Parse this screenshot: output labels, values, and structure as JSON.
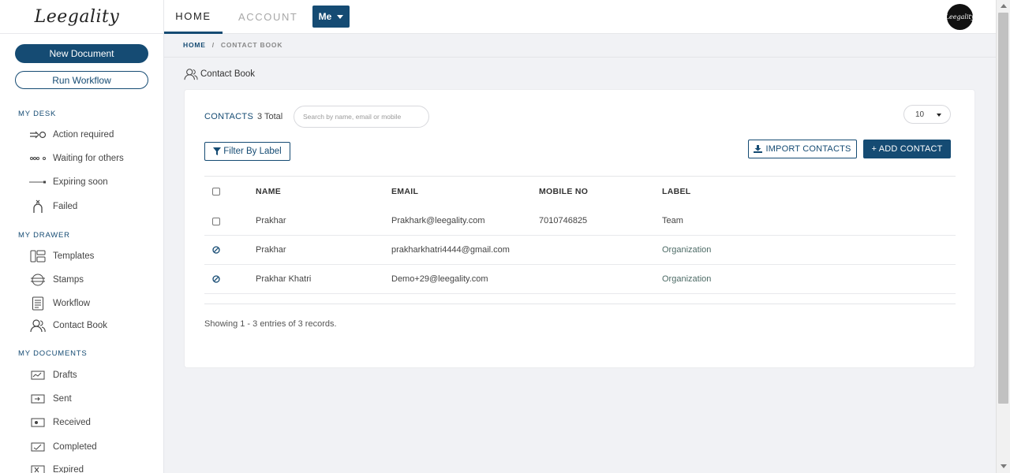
{
  "app": {
    "logo_text": "Leegality",
    "avatar_text": "Leegality"
  },
  "sidebar": {
    "new_document": "New Document",
    "run_workflow": "Run Workflow",
    "sections": {
      "my_desk": "MY DESK",
      "my_drawer": "MY DRAWER",
      "my_documents": "MY DOCUMENTS"
    },
    "desk_items": [
      {
        "label": "Action required",
        "icon": "action-required-icon"
      },
      {
        "label": "Waiting for others",
        "icon": "waiting-icon"
      },
      {
        "label": "Expiring soon",
        "icon": "expiring-icon"
      },
      {
        "label": "Failed",
        "icon": "failed-icon"
      }
    ],
    "drawer_items": [
      {
        "label": "Templates",
        "icon": "templates-icon"
      },
      {
        "label": "Stamps",
        "icon": "stamps-icon"
      },
      {
        "label": "Workflow",
        "icon": "workflow-icon"
      },
      {
        "label": "Contact Book",
        "icon": "contact-book-icon"
      }
    ],
    "document_items": [
      {
        "label": "Drafts",
        "icon": "drafts-icon"
      },
      {
        "label": "Sent",
        "icon": "sent-icon"
      },
      {
        "label": "Received",
        "icon": "received-icon"
      },
      {
        "label": "Completed",
        "icon": "completed-icon"
      },
      {
        "label": "Expired",
        "icon": "expired-icon"
      }
    ]
  },
  "topbar": {
    "tab_home": "HOME",
    "tab_account": "ACCOUNT",
    "me_button": "Me"
  },
  "breadcrumb": {
    "home": "HOME",
    "separator": "/",
    "current": "CONTACT BOOK"
  },
  "page": {
    "title": "Contact Book"
  },
  "contacts": {
    "label": "CONTACTS",
    "count": "3 Total",
    "search_placeholder": "Search by name, email or mobile",
    "per_page": "10",
    "filter_button": "Filter By Label",
    "import_button": "IMPORT CONTACTS",
    "add_button": "+ ADD CONTACT",
    "columns": {
      "name": "NAME",
      "email": "EMAIL",
      "mobile": "MOBILE NO",
      "label": "LABEL"
    },
    "rows": [
      {
        "name": "Prakhar",
        "email": "Prakhark@leegality.com",
        "mobile": "7010746825",
        "label": "Team",
        "selectable": true
      },
      {
        "name": "Prakhar",
        "email": "prakharkhatri4444@gmail.com",
        "mobile": "",
        "label": "Organization",
        "selectable": false
      },
      {
        "name": "Prakhar Khatri",
        "email": "Demo+29@leegality.com",
        "mobile": "",
        "label": "Organization",
        "selectable": false
      }
    ],
    "summary": "Showing 1 - 3 entries of 3 records."
  },
  "colors": {
    "primary": "#154b73",
    "org_label": "#4d6b66"
  }
}
